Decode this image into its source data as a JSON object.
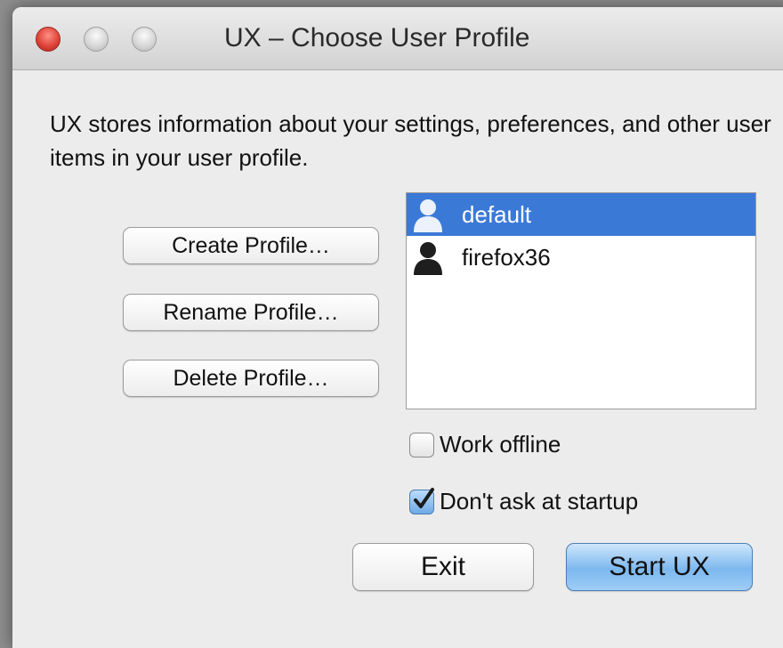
{
  "window": {
    "title": "UX – Choose User Profile"
  },
  "description": "UX stores information about your settings, preferences, and other user items in your user profile.",
  "buttons": {
    "create": "Create Profile…",
    "rename": "Rename Profile…",
    "delete": "Delete Profile…",
    "exit": "Exit",
    "start": "Start UX"
  },
  "profiles": [
    {
      "name": "default",
      "selected": true,
      "icon": "user-icon"
    },
    {
      "name": "firefox36",
      "selected": false,
      "icon": "user-icon"
    }
  ],
  "options": {
    "work_offline": {
      "label": "Work offline",
      "checked": false
    },
    "dont_ask": {
      "label": "Don't ask at startup",
      "checked": true
    }
  },
  "colors": {
    "selection": "#3b79d7",
    "default_button": "#7cb8ef",
    "close_button": "#e0443a"
  }
}
